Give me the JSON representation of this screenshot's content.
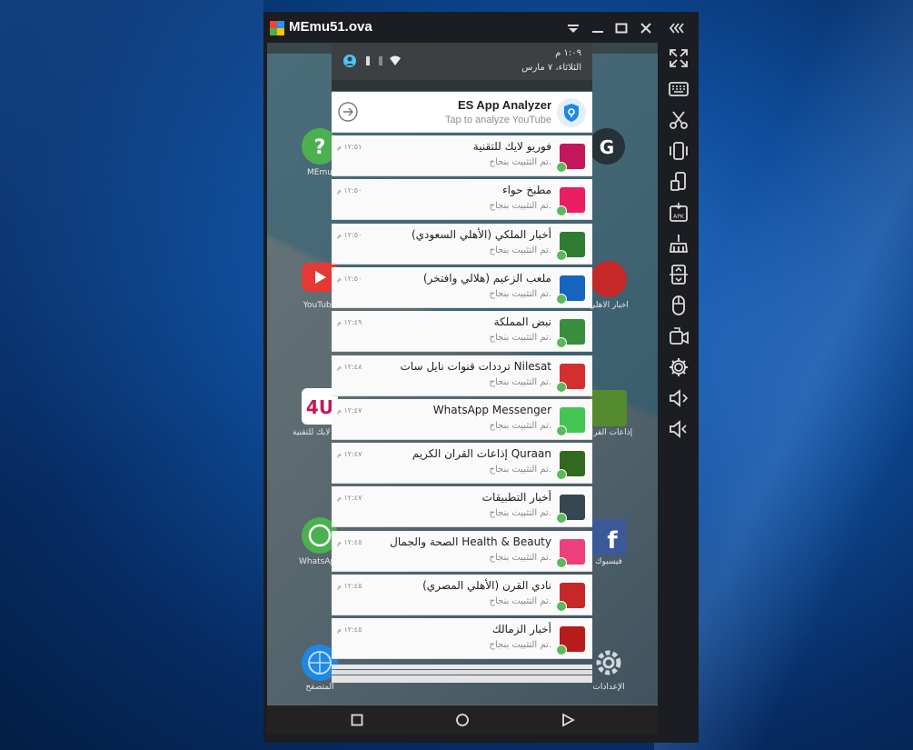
{
  "window": {
    "title": "MEmu51.ova"
  },
  "shade": {
    "time": "١:٠٩ م",
    "date": "الثلاثاء، ٧ مارس"
  },
  "analyzer": {
    "title": "ES App Analyzer",
    "subtitle": "Tap to analyze YouTube"
  },
  "notifications": [
    {
      "title": "فوريو لايك للتقنية",
      "sub": "تم التثبيت بنجاح.",
      "time": "١٢:٥١ م",
      "icon": "4u-icon",
      "color": "#c2185b"
    },
    {
      "title": "مطبخ حواء",
      "sub": "تم التثبيت بنجاح.",
      "time": "١٢:٥٠ م",
      "icon": "kitchen-icon",
      "color": "#e91e63"
    },
    {
      "title": "أخبار الملكي (الأهلي السعودي)",
      "sub": "تم التثبيت بنجاح.",
      "time": "١٢:٥٠ م",
      "icon": "ahli-saudi-icon",
      "color": "#2e7d32"
    },
    {
      "title": "ملعب الزعيم (هلالي وافتخر)",
      "sub": "تم التثبيت بنجاح.",
      "time": "١٢:٥٠ م",
      "icon": "hilal-icon",
      "color": "#1565c0"
    },
    {
      "title": "نبض المملكة",
      "sub": "تم التثبيت بنجاح.",
      "time": "١٢:٤٩ م",
      "icon": "ksa-icon",
      "color": "#388e3c"
    },
    {
      "title": "ترددات قنوات نايل سات Nilesat",
      "sub": "تم التثبيت بنجاح.",
      "time": "١٢:٤٨ م",
      "icon": "nilesat-icon",
      "color": "#d32f2f"
    },
    {
      "title": "WhatsApp Messenger",
      "sub": "تم التثبيت بنجاح.",
      "time": "١٢:٤٧ م",
      "icon": "whatsapp-icon",
      "color": "#43c553"
    },
    {
      "title": "إذاعات القران الكريم Quraan",
      "sub": "تم التثبيت بنجاح.",
      "time": "١٢:٤٧ م",
      "icon": "quran-icon",
      "color": "#33691e"
    },
    {
      "title": "أخبار التطبيقات",
      "sub": "تم التثبيت بنجاح.",
      "time": "١٢:٤٧ م",
      "icon": "apps-news-icon",
      "color": "#37474f"
    },
    {
      "title": "الصحة والجمال Health & Beauty",
      "sub": "تم التثبيت بنجاح.",
      "time": "١٢:٤٥ م",
      "icon": "health-beauty-icon",
      "color": "#ec407a"
    },
    {
      "title": "نادي القرن (الأهلي المصري)",
      "sub": "تم التثبيت بنجاح.",
      "time": "١٢:٤٥ م",
      "icon": "ahly-egypt-icon",
      "color": "#c62828"
    },
    {
      "title": "أخبار الزمالك",
      "sub": "تم التثبيت بنجاح.",
      "time": "١٢:٤٥ م",
      "icon": "zamalek-icon",
      "color": "#b71c1c"
    }
  ],
  "peek_sub": "تم التثبيت بنجاح.",
  "home_labels": {
    "memu": "MEmu",
    "youtube": "YouTube",
    "fouru": "فوريو لايك للتقنية",
    "whatsapp": "WhatsApp",
    "facebook": "فيسبوك",
    "quran": "إذاعات القرآن",
    "ahly": "أخبار الأهلي",
    "globe": "المتصفح",
    "settings": "الإعدادات"
  }
}
